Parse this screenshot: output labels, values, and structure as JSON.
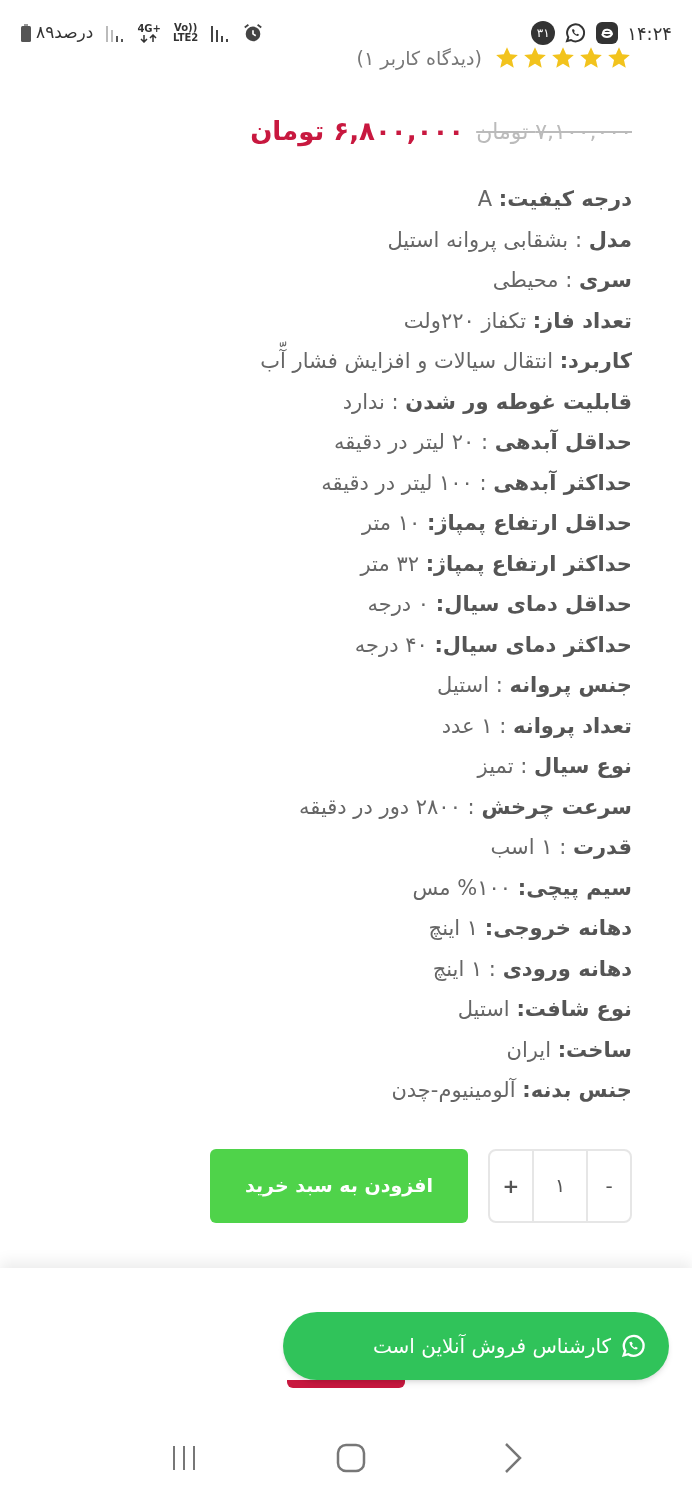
{
  "status_bar": {
    "time": "۱۴:۲۴",
    "notification_count": "۳۱",
    "network": "4G+",
    "volte": "Vo))",
    "lte": "LTE2",
    "battery": "۸۹درصد"
  },
  "rating": {
    "stars": 5,
    "reviews": "(دیدگاه کاربر ۱)"
  },
  "price": {
    "old": "۷,۱۰۰,۰۰۰ تومان",
    "current": "۶,۸۰۰,۰۰۰ تومان"
  },
  "specs": [
    "**درجه کیفیت:** A",
    "**مدل** : بشقابی پروانه استیل",
    "**سری** : محیطی",
    "**تعداد فاز:** تکفاز ۲۲۰ولت",
    "**کاربرد:** انتقال سیالات و افزایش فشار آّب",
    "**قابلیت غوطه ور شدن** : ندارد",
    "**حداقل آبدهی** : ۲۰ لیتر در دقیقه",
    "**حداکثر آبدهی** : ۱۰۰ لیتر در دقیقه",
    "**حداقل ارتفاع پمپاژ:** ۱۰ متر",
    "**حداکثر ارتفاع پمپاژ:** ۳۲ متر",
    "**حداقل دمای سیال:** ۰ درجه",
    "**حداکثر دمای سیال:** ۴۰ درجه",
    "**جنس پروانه** : استیل",
    "**تعداد پروانه** : ۱ عدد",
    "**نوع سیال** : تمیز",
    "**سرعت چرخش** : ۲۸۰۰ دور در دقیقه",
    "**قدرت** : ۱ اسب",
    "**سیم پیچی:** ۱۰۰% مس",
    "**دهانه خروجی:** ۱ اینچ",
    "**دهانه ورودی** : ۱ اینچ",
    "**نوع شافت:** استیل",
    "**ساخت:** ایران",
    "**جنس بدنه:** آلومینیوم-چدن"
  ],
  "cart": {
    "minus": "-",
    "quantity": "۱",
    "plus": "+",
    "add_button": "افزودن به سبد خرید"
  },
  "chat_button": "کارشناس فروش آنلاین است"
}
